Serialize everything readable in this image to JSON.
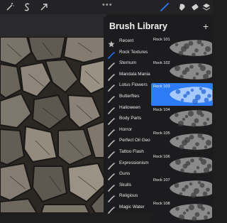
{
  "toolbar": {
    "icons": [
      "adjustments-wand-icon",
      "selection-s-icon",
      "transform-arrow-icon",
      "brush-icon",
      "smudge-icon",
      "eraser-icon",
      "layers-icon"
    ],
    "more_label": "•••"
  },
  "panel": {
    "title": "Brush Library",
    "add_label": "+"
  },
  "brush_sets": [
    {
      "label": "Recent",
      "icon": "star-icon"
    },
    {
      "label": "Rock Textures",
      "icon": "brush-stroke-icon",
      "selected": true
    },
    {
      "label": "Sternum",
      "icon": "brush-stroke-icon"
    },
    {
      "label": "Mandala Mania 2",
      "icon": "brush-stroke-icon"
    },
    {
      "label": "Lotus Flowers",
      "icon": "brush-stroke-icon"
    },
    {
      "label": "Butterflies",
      "icon": "brush-stroke-icon"
    },
    {
      "label": "Halloween",
      "icon": "brush-stroke-icon"
    },
    {
      "label": "Body Parts",
      "icon": "brush-stroke-icon"
    },
    {
      "label": "Horror",
      "icon": "brush-stroke-icon"
    },
    {
      "label": "Perfect Oil Geo",
      "icon": "brush-stroke-icon"
    },
    {
      "label": "Tattoo Flash",
      "icon": "brush-stroke-icon"
    },
    {
      "label": "Expressionism",
      "icon": "brush-stroke-icon"
    },
    {
      "label": "Guns",
      "icon": "brush-stroke-icon"
    },
    {
      "label": "Skulls",
      "icon": "brush-stroke-icon"
    },
    {
      "label": "Religious",
      "icon": "brush-stroke-icon"
    },
    {
      "label": "Magic Water",
      "icon": "brush-stroke-icon"
    }
  ],
  "brushes": [
    {
      "name": "Rock 101"
    },
    {
      "name": "Rock 102"
    },
    {
      "name": "Rock 103",
      "selected": true
    },
    {
      "name": "Rock 104"
    },
    {
      "name": "Rock 105"
    },
    {
      "name": "Rock 106"
    },
    {
      "name": "Rock 107"
    },
    {
      "name": "Rock 108"
    }
  ],
  "colors": {
    "accent": "#1e6ff5",
    "selected_brush_bg": "#2d7cf6",
    "panel_bg": "#1c1c1e",
    "text": "#e6e6e6"
  }
}
